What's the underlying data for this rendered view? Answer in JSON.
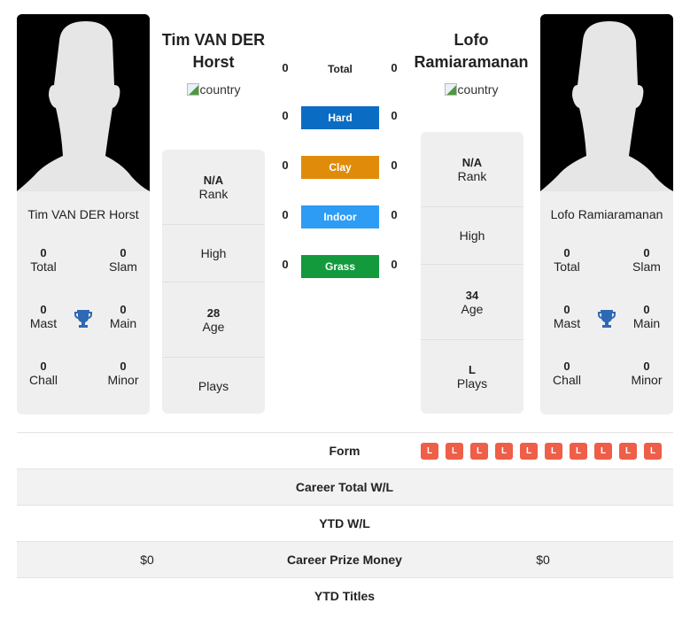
{
  "player1": {
    "name": "Tim VAN DER Horst",
    "title_line1": "Tim VAN DER",
    "title_line2": "Horst",
    "country_alt": "country",
    "stats": {
      "total": {
        "value": "0",
        "label": "Total"
      },
      "slam": {
        "value": "0",
        "label": "Slam"
      },
      "mast": {
        "value": "0",
        "label": "Mast"
      },
      "main": {
        "value": "0",
        "label": "Main"
      },
      "chall": {
        "value": "0",
        "label": "Chall"
      },
      "minor": {
        "value": "0",
        "label": "Minor"
      }
    },
    "info": {
      "rank": {
        "value": "N/A",
        "label": "Rank"
      },
      "high": {
        "value": "",
        "label": "High"
      },
      "age": {
        "value": "28",
        "label": "Age"
      },
      "plays": {
        "value": "",
        "label": "Plays"
      }
    }
  },
  "player2": {
    "name": "Lofo Ramiaramanan",
    "title_line1": "Lofo",
    "title_line2": "Ramiaramanan",
    "country_alt": "country",
    "stats": {
      "total": {
        "value": "0",
        "label": "Total"
      },
      "slam": {
        "value": "0",
        "label": "Slam"
      },
      "mast": {
        "value": "0",
        "label": "Mast"
      },
      "main": {
        "value": "0",
        "label": "Main"
      },
      "chall": {
        "value": "0",
        "label": "Chall"
      },
      "minor": {
        "value": "0",
        "label": "Minor"
      }
    },
    "info": {
      "rank": {
        "value": "N/A",
        "label": "Rank"
      },
      "high": {
        "value": "",
        "label": "High"
      },
      "age": {
        "value": "34",
        "label": "Age"
      },
      "plays": {
        "value": "L",
        "label": "Plays"
      }
    }
  },
  "h2h": [
    {
      "label": "Total",
      "left": "0",
      "right": "0",
      "color": ""
    },
    {
      "label": "Hard",
      "left": "0",
      "right": "0",
      "color": "#0a6dc3"
    },
    {
      "label": "Clay",
      "left": "0",
      "right": "0",
      "color": "#e08c0a"
    },
    {
      "label": "Indoor",
      "left": "0",
      "right": "0",
      "color": "#2d9cf5"
    },
    {
      "label": "Grass",
      "left": "0",
      "right": "0",
      "color": "#129a3c"
    }
  ],
  "comparison": {
    "form_label": "Form",
    "form_right": [
      "L",
      "L",
      "L",
      "L",
      "L",
      "L",
      "L",
      "L",
      "L",
      "L"
    ],
    "rows": [
      {
        "label": "Career Total W/L",
        "left": "",
        "right": ""
      },
      {
        "label": "YTD W/L",
        "left": "",
        "right": ""
      },
      {
        "label": "Career Prize Money",
        "left": "$0",
        "right": "$0"
      },
      {
        "label": "YTD Titles",
        "left": "",
        "right": ""
      }
    ]
  },
  "colors": {
    "form_loss": "#ee5e48",
    "trophy": "#2e6ab3"
  }
}
